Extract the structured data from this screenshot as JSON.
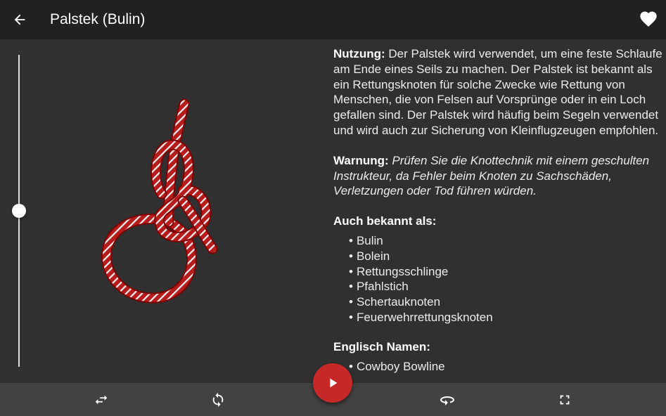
{
  "appbar": {
    "title": "Palstek (Bulin)",
    "back_icon": "arrow-back-icon",
    "favorite_icon": "heart-icon"
  },
  "slider": {
    "level": 0.5
  },
  "info": {
    "usage_label": "Nutzung:",
    "usage_text": " Der Palstek wird verwendet, um eine feste Schlaufe am Ende eines Seils zu machen. Der Palstek ist bekannt als ein Rettungsknoten für solche Zwecke wie Rettung von Menschen, die von Felsen auf Vorsprünge oder in ein Loch gefallen sind. Der Palstek wird häufig beim Segeln verwendet und wird auch zur Sicherung von Kleinflugzeugen empfohlen.",
    "warning_label": "Warnung:",
    "warning_text": " Prüfen Sie die Knottechnik mit einem geschulten Instrukteur, da Fehler beim Knoten zu Sachschäden, Verletzungen oder Tod führen würden.",
    "aka_heading": "Auch bekannt als:",
    "aka_items": [
      "Bulin",
      "Bolein",
      "Rettungsschlinge",
      "Pfahlstich",
      "Schertauknoten",
      "Feuerwehrrettungsknoten"
    ],
    "english_heading": "Englisch Namen:",
    "english_items": [
      "Cowboy Bowline"
    ]
  },
  "controls": {
    "swap_icon": "swap-horiz-icon",
    "repeat_icon": "sync-icon",
    "play_icon": "play-arrow-icon",
    "rotate_icon": "rotate-360-icon",
    "fullscreen_icon": "fullscreen-icon"
  },
  "colors": {
    "appbar": "#212121",
    "background": "#303030",
    "bottombar": "#424242",
    "accent": "#c62828",
    "rope": "#b71c1c"
  }
}
